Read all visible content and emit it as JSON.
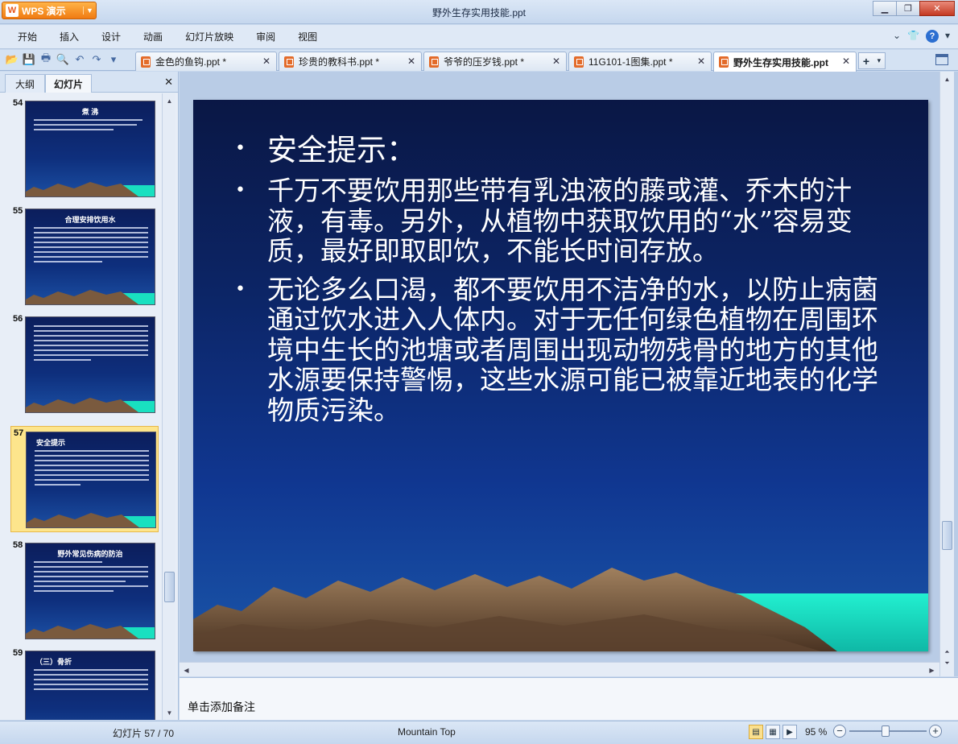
{
  "window": {
    "app_name": "WPS 演示",
    "app_logo": "W",
    "title": "野外生存实用技能.ppt",
    "controls": [
      "minimize-icon",
      "maximize-icon",
      "close-icon"
    ]
  },
  "menu": {
    "items": [
      "开始",
      "插入",
      "设计",
      "动画",
      "幻灯片放映",
      "审阅",
      "视图"
    ]
  },
  "quick_access": [
    "open-icon",
    "save-icon",
    "print-icon",
    "print-preview-icon",
    "undo-icon",
    "redo-icon",
    "dropdown-icon"
  ],
  "tabs": [
    {
      "label": "金色的鱼钩.ppt *",
      "active": false
    },
    {
      "label": "珍贵的教科书.ppt *",
      "active": false
    },
    {
      "label": "爷爷的压岁钱.ppt *",
      "active": false
    },
    {
      "label": "11G101-1图集.ppt *",
      "active": false
    },
    {
      "label": "野外生存实用技能.ppt",
      "active": true
    }
  ],
  "left_pane": {
    "tab_outline": "大纲",
    "tab_slides": "幻灯片",
    "thumbnails": [
      {
        "number": "54",
        "title": "煮 沸"
      },
      {
        "number": "55",
        "title": "合理安排饮用水"
      },
      {
        "number": "56",
        "title": ""
      },
      {
        "number": "57",
        "title": "安全提示",
        "active": true
      },
      {
        "number": "58",
        "title": "野外常见伤病的防治"
      },
      {
        "number": "59",
        "title": "（三）骨折"
      }
    ]
  },
  "slide": {
    "bullets": [
      "安全提示：",
      "千万不要饮用那些带有乳浊液的藤或灌、乔木的汁液，有毒。另外，从植物中获取饮用的“水”容易变质，最好即取即饮，不能长时间存放。",
      "无论多么口渴，都不要饮用不洁净的水，以防止病菌通过饮水进入人体内。对于无任何绿色植物在周围环境中生长的池塘或者周围出现动物残骨的地方的其他水源要保持警惕，这些水源可能已被靠近地表的化学物质污染。"
    ],
    "bullet_char": "•"
  },
  "notes": {
    "placeholder": "单击添加备注"
  },
  "status": {
    "slide_count": "幻灯片 57 / 70",
    "theme": "Mountain Top",
    "zoom": "95 %",
    "zoom_level": 0.5
  },
  "colors": {
    "accent_orange": "#f07b12",
    "slide_top": "#0a1745",
    "slide_bottom": "#1a55a8",
    "mountain": "#7a5a3e",
    "sea": "#19e0c0"
  }
}
